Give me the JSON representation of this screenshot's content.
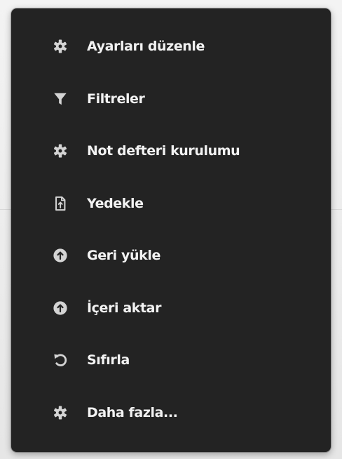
{
  "menu": {
    "items": [
      {
        "label": "Ayarları düzenle",
        "icon": "gear-icon"
      },
      {
        "label": "Filtreler",
        "icon": "filter-icon"
      },
      {
        "label": "Not defteri kurulumu",
        "icon": "gear-icon"
      },
      {
        "label": "Yedekle",
        "icon": "file-export-icon"
      },
      {
        "label": "Geri yükle",
        "icon": "upload-circle-icon"
      },
      {
        "label": "İçeri aktar",
        "icon": "upload-circle-icon"
      },
      {
        "label": "Sıfırla",
        "icon": "undo-icon"
      },
      {
        "label": "Daha fazla...",
        "icon": "gear-icon"
      }
    ]
  },
  "colors": {
    "menu_background": "#232323",
    "text": "#f2f2f2",
    "icon": "#d4d4d4"
  }
}
